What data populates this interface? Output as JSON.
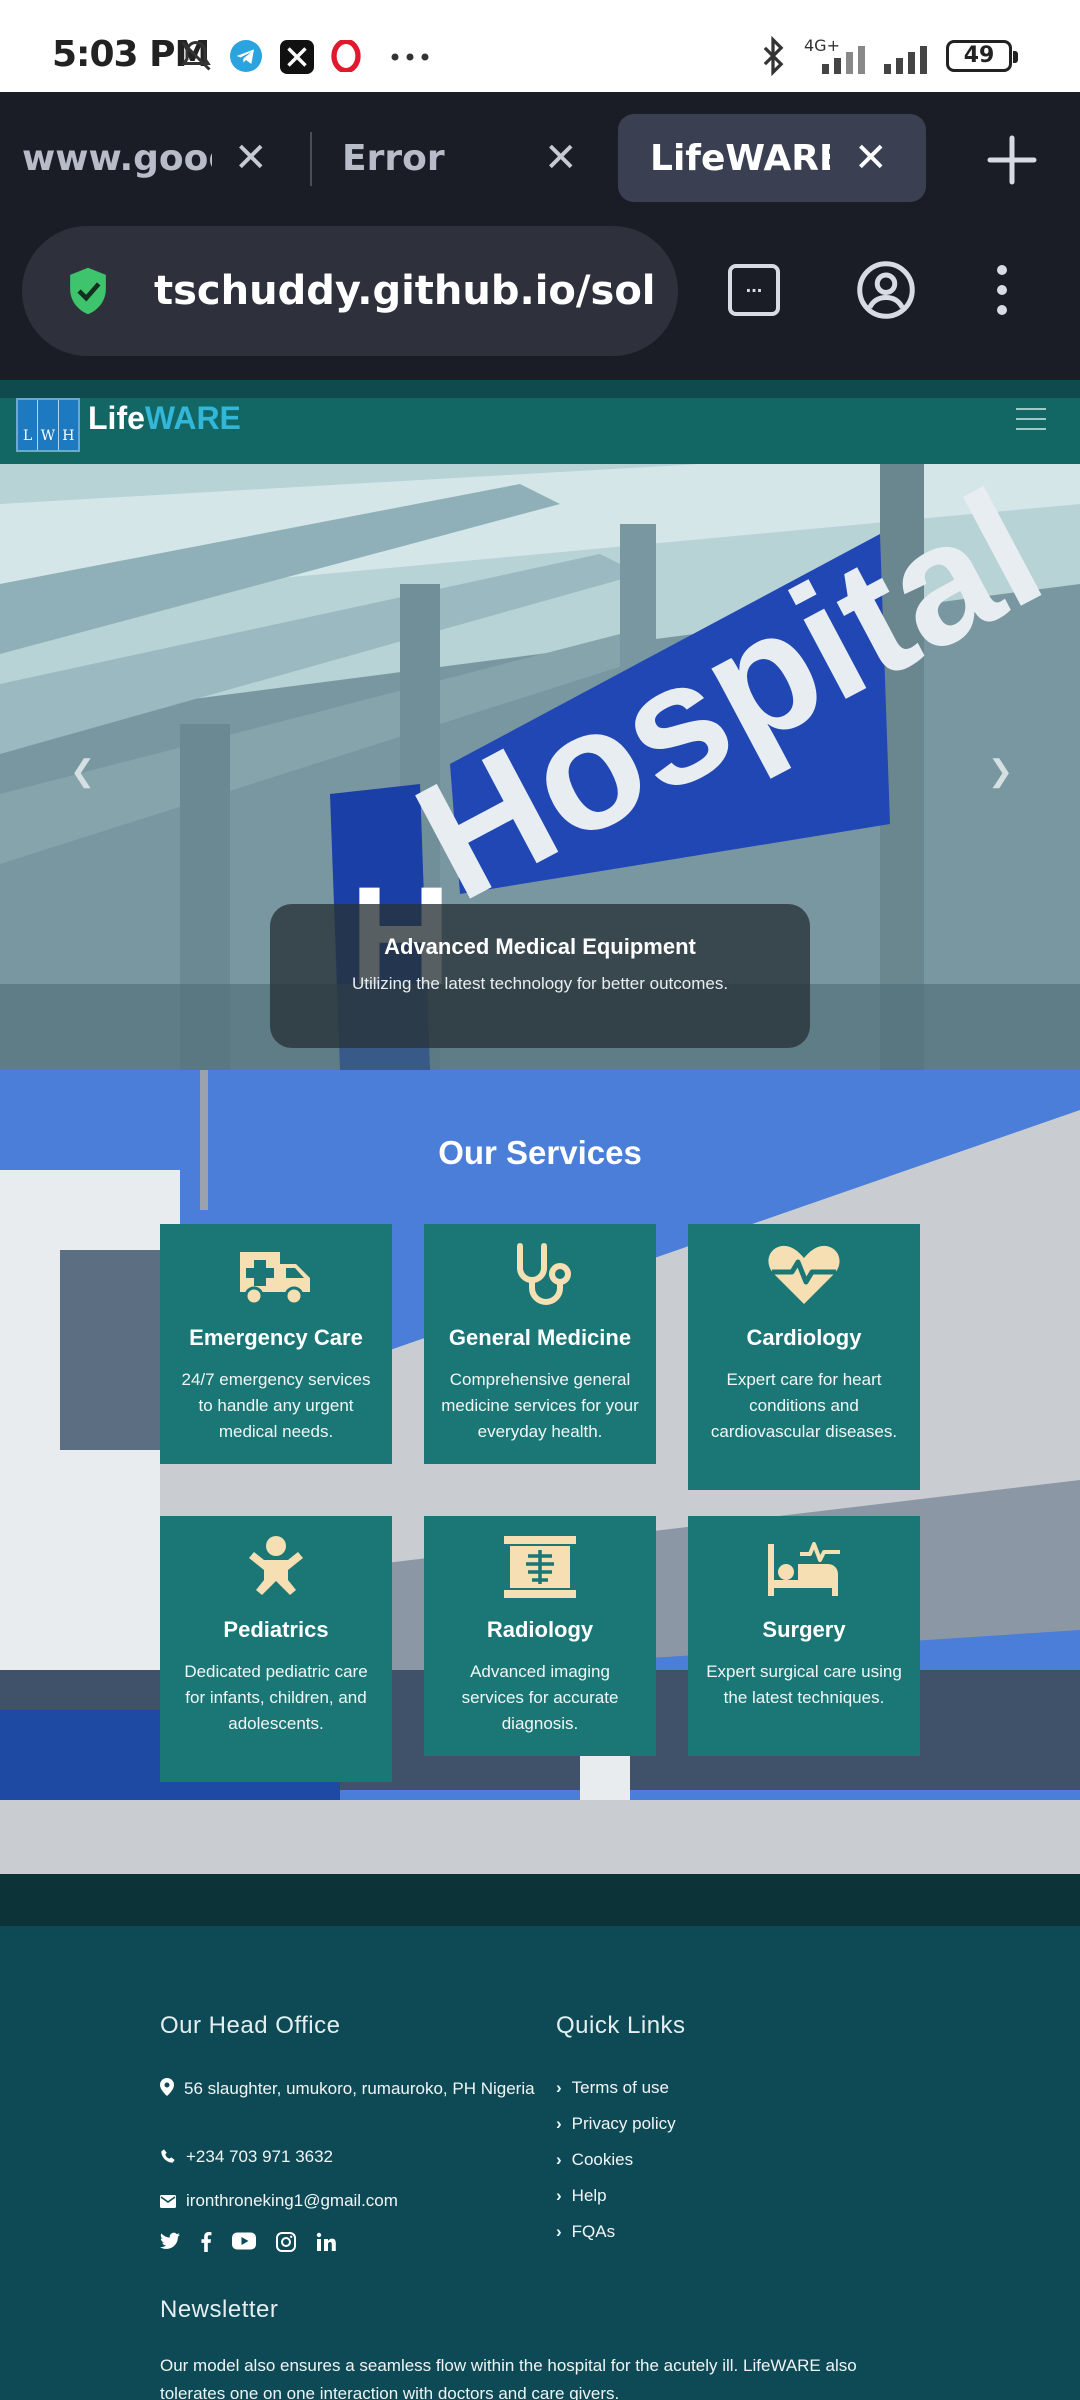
{
  "status_bar": {
    "time": "5:03 PM",
    "network": "4G+",
    "battery": "49"
  },
  "browser": {
    "tabs": [
      {
        "label": "www.googl",
        "active": false
      },
      {
        "label": "Error",
        "active": false
      },
      {
        "label": "LifeWARE.c",
        "active": true
      }
    ],
    "url": "tschuddy.github.io/solo_",
    "tabs_count_label": "..."
  },
  "site": {
    "logo": {
      "letters": [
        "L",
        "W",
        "H"
      ],
      "name_part1": "Life",
      "name_part2": "WARE"
    },
    "hero": {
      "sign_text": "Hospital",
      "caption_title": "Advanced Medical Equipment",
      "caption_text": "Utilizing the latest technology for better outcomes."
    },
    "services": {
      "title": "Our Services",
      "items": [
        {
          "icon": "ambulance-icon",
          "title": "Emergency Care",
          "text": "24/7 emergency services to handle any urgent medical needs."
        },
        {
          "icon": "stethoscope-icon",
          "title": "General Medicine",
          "text": "Comprehensive general medicine services for your everyday health."
        },
        {
          "icon": "heartbeat-icon",
          "title": "Cardiology",
          "text": "Expert care for heart conditions and cardiovascular diseases."
        },
        {
          "icon": "baby-icon",
          "title": "Pediatrics",
          "text": "Dedicated pediatric care for infants, children, and adolescents."
        },
        {
          "icon": "x-ray-icon",
          "title": "Radiology",
          "text": "Advanced imaging services for accurate diagnosis."
        },
        {
          "icon": "bed-pulse-icon",
          "title": "Surgery",
          "text": "Expert surgical care using the latest techniques."
        }
      ]
    },
    "footer": {
      "head_office_title": "Our Head Office",
      "address": "56 slaughter, umukoro, rumauroko, PH Nigeria",
      "phone": "+234 703 971 3632",
      "email": "ironthroneking1@gmail.com",
      "quick_links_title": "Quick Links",
      "quick_links": [
        "Terms of use",
        "Privacy policy",
        "Cookies",
        "Help",
        "FQAs"
      ],
      "socials": [
        "twitter-icon",
        "facebook-icon",
        "youtube-icon",
        "instagram-icon",
        "linkedin-icon"
      ],
      "newsletter_title": "Newsletter",
      "newsletter_text": "Our model also ensures a seamless flow within the hospital for the acutely ill. LifeWARE also tolerates one on one interaction with doctors and care givers."
    }
  },
  "colors": {
    "header_teal": "#126765",
    "card_teal": "#1a7775",
    "footer_bg": "#0e4a55",
    "brand_cyan": "#32b7d9",
    "icon_cream": "#f5dfb3"
  }
}
